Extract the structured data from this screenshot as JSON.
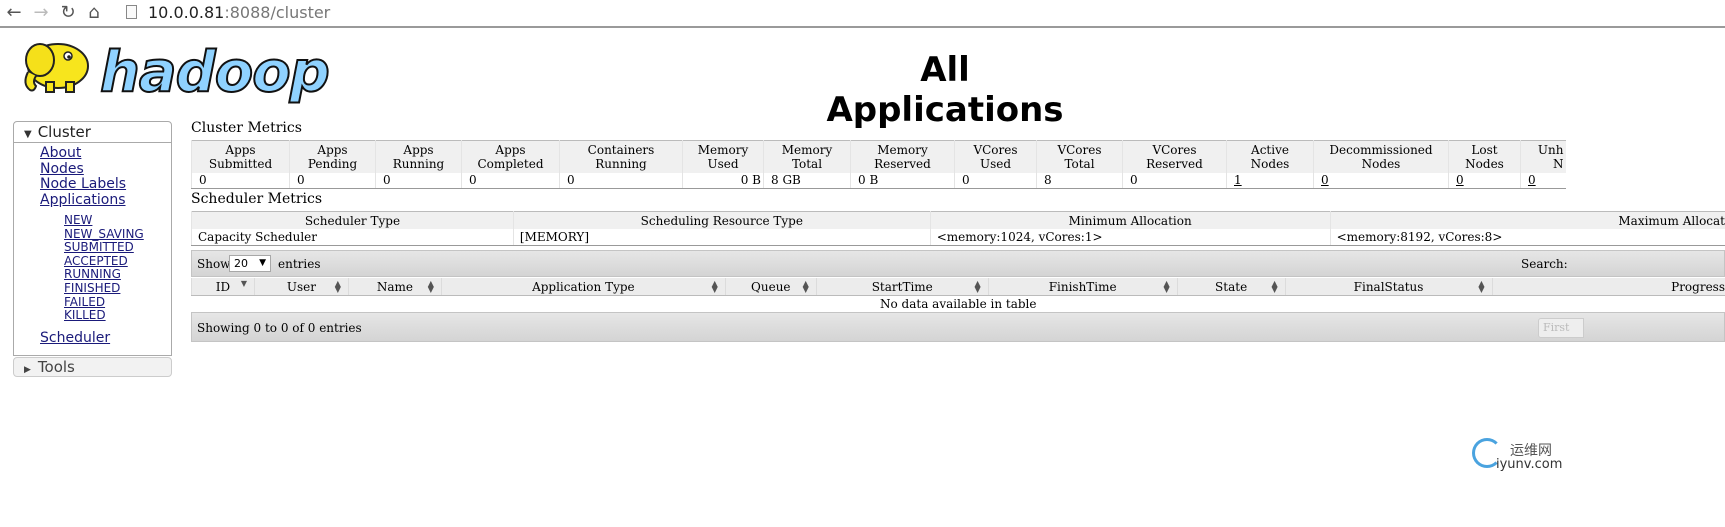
{
  "browser": {
    "back_icon": "←",
    "forward_icon": "→",
    "reload_icon": "↻",
    "home_icon": "⌂",
    "url_host": "10.0.0.81",
    "url_rest": ":8088/cluster"
  },
  "logo": {
    "text": "hadoop"
  },
  "page_title": "All Applications",
  "nav": {
    "cluster_label": "Cluster",
    "cluster_items": [
      "About",
      "Nodes",
      "Node Labels",
      "Applications"
    ],
    "app_states": [
      "NEW",
      "NEW_SAVING",
      "SUBMITTED",
      "ACCEPTED",
      "RUNNING",
      "FINISHED",
      "FAILED",
      "KILLED"
    ],
    "scheduler": "Scheduler",
    "tools_label": "Tools"
  },
  "cluster_metrics": {
    "heading": "Cluster Metrics",
    "columns": [
      [
        "Apps",
        "Submitted"
      ],
      [
        "Apps",
        "Pending"
      ],
      [
        "Apps",
        "Running"
      ],
      [
        "Apps",
        "Completed"
      ],
      [
        "Containers",
        "Running"
      ],
      [
        "Memory",
        "Used"
      ],
      [
        "Memory",
        "Total"
      ],
      [
        "Memory",
        "Reserved"
      ],
      [
        "VCores",
        "Used"
      ],
      [
        "VCores",
        "Total"
      ],
      [
        "VCores",
        "Reserved"
      ],
      [
        "Active",
        "Nodes"
      ],
      [
        "Decommissioned",
        "Nodes"
      ],
      [
        "Lost",
        "Nodes"
      ],
      [
        "Unh",
        "N"
      ]
    ],
    "values": [
      "0",
      "0",
      "0",
      "0",
      "0",
      "0 B",
      "8 GB",
      "0 B",
      "0",
      "8",
      "0",
      "1",
      "0",
      "0",
      "0"
    ]
  },
  "scheduler_metrics": {
    "heading": "Scheduler Metrics",
    "columns": [
      "Scheduler Type",
      "Scheduling Resource Type",
      "Minimum Allocation",
      "Maximum Allocat"
    ],
    "values": [
      "Capacity Scheduler",
      "[MEMORY]",
      "<memory:1024, vCores:1>",
      "<memory:8192, vCores:8>"
    ]
  },
  "apps_table": {
    "show_label": "Show",
    "page_size": "20",
    "entries_label": "entries",
    "search_label": "Search:",
    "columns": [
      "ID",
      "User",
      "Name",
      "Application Type",
      "Queue",
      "StartTime",
      "FinishTime",
      "State",
      "FinalStatus",
      "Progress"
    ],
    "empty_message": "No data available in table",
    "info": "Showing 0 to 0 of 0 entries",
    "first_label": "First"
  },
  "watermark": {
    "cn": "运维网",
    "en": "iyunv.com"
  }
}
